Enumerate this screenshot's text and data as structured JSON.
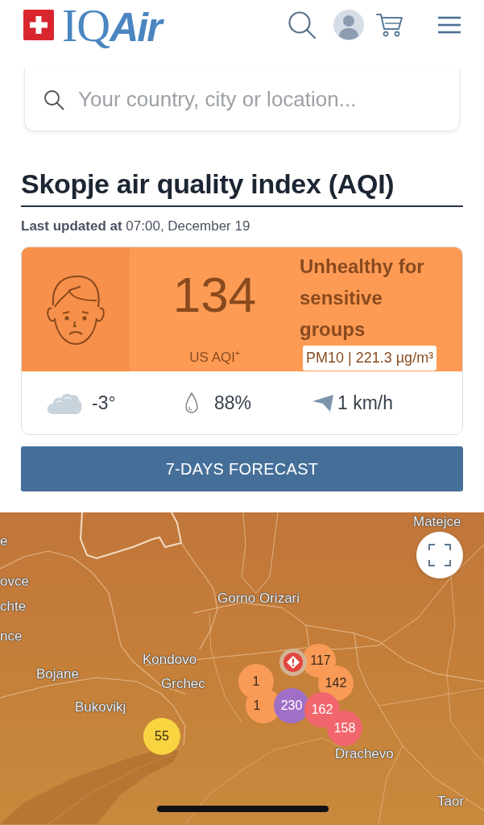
{
  "header": {
    "logo": {
      "serif_part": "IQ",
      "italic_part": "Air"
    }
  },
  "search": {
    "placeholder": "Your country, city or location..."
  },
  "title": "Skopje air quality index (AQI)",
  "last_updated": "**Last updated at** 07:00, December 19",
  "aqi": {
    "value": "134",
    "unit": "US AQI$^{+}$",
    "status": "Unhealthy for sensitive groups",
    "pollutant": "PM10 | 221.3 µg/m³"
  },
  "weather": [
    {
      "kind": "temperature",
      "value": "-3°"
    },
    {
      "kind": "humidity",
      "value": "88%"
    },
    {
      "kind": "wind",
      "value": "1 km/h"
    }
  ],
  "forecast_button": "7-DAYS FORECAST",
  "map": {
    "places": [
      "Matejce",
      "e",
      "ovce",
      "chte",
      "nce",
      "Gorno Orizari",
      "Kondovo",
      "Bojane",
      "Grchec",
      "Bukovikj",
      "Drachevo",
      "Taor"
    ],
    "markers": [
      {
        "kind": "station",
        "value": "1",
        "color": "#f99b57"
      },
      {
        "kind": "station",
        "value": "1",
        "color": "#f99b57"
      },
      {
        "kind": "station",
        "value": "117",
        "color": "#f99b57"
      },
      {
        "kind": "alert"
      },
      {
        "kind": "station",
        "value": "142",
        "color": "#f99b57"
      },
      {
        "kind": "station",
        "value": "230",
        "color": "#a06fc6"
      },
      {
        "kind": "station",
        "value": "162",
        "color": "#f1666d"
      },
      {
        "kind": "station",
        "value": "158",
        "color": "#f1666d"
      },
      {
        "kind": "station",
        "value": "55",
        "color": "#f8d440"
      }
    ]
  }
}
